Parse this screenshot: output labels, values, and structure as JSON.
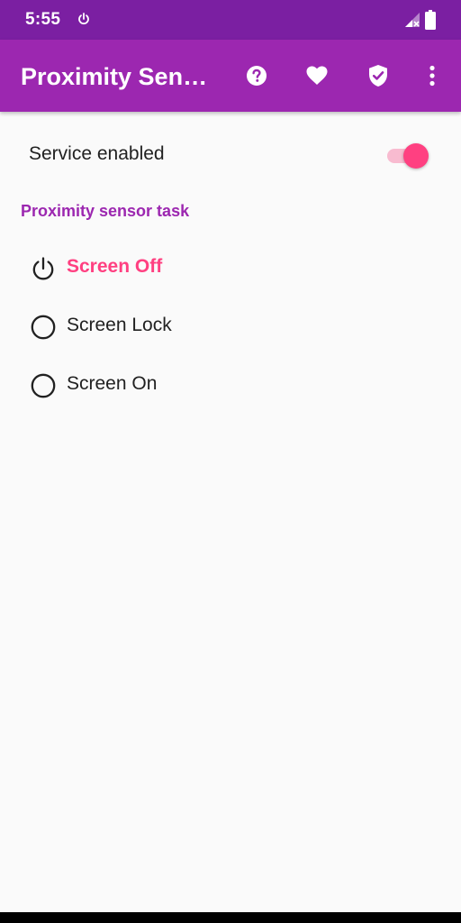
{
  "status_bar": {
    "time": "5:55",
    "icons": [
      "power-icon",
      "signal-off-icon",
      "battery-icon"
    ]
  },
  "app_bar": {
    "title": "Proximity Sensor",
    "actions": [
      {
        "name": "help-icon"
      },
      {
        "name": "heart-icon"
      },
      {
        "name": "shield-check-icon"
      },
      {
        "name": "more-vert-icon"
      }
    ]
  },
  "service": {
    "label": "Service enabled",
    "enabled": true
  },
  "task": {
    "header": "Proximity sensor task",
    "options": [
      {
        "label": "Screen Off",
        "icon": "power-icon",
        "selected": true
      },
      {
        "label": "Screen Lock",
        "icon": "radio-unchecked-icon",
        "selected": false
      },
      {
        "label": "Screen On",
        "icon": "radio-unchecked-icon",
        "selected": false
      }
    ]
  },
  "colors": {
    "status_bar": "#7b1fa2",
    "app_bar": "#9c27b0",
    "accent": "#ff4081",
    "switch_track": "#f8bbd0",
    "background": "#fafafa",
    "text": "#212121"
  }
}
